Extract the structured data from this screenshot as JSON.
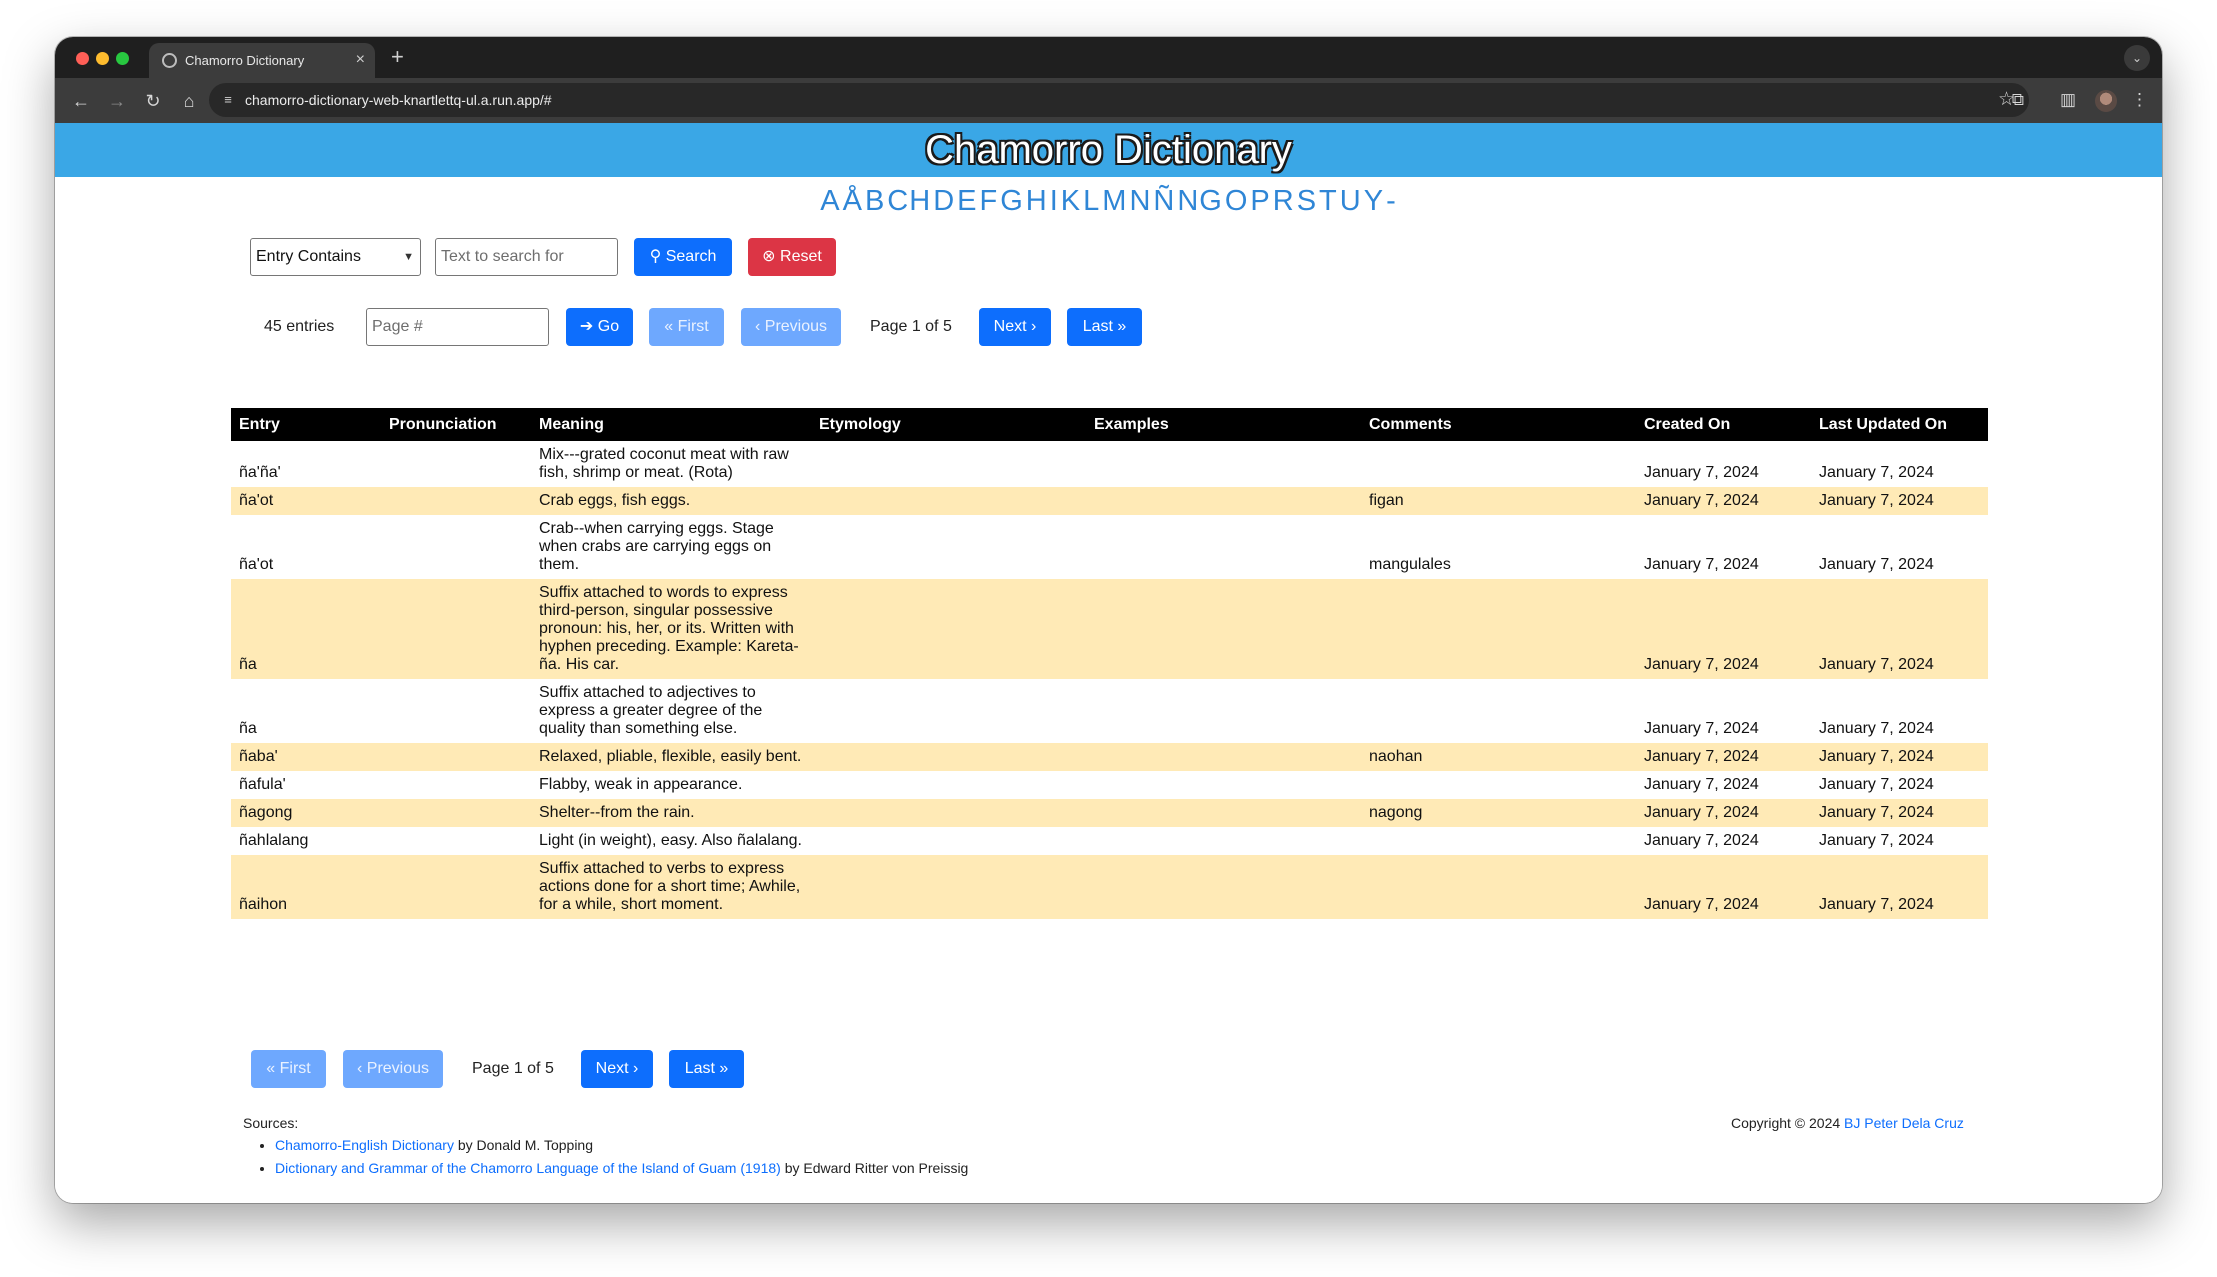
{
  "browser": {
    "tab_title": "Chamorro Dictionary",
    "tab_close": "×",
    "new_tab": "+",
    "url": "chamorro-dictionary-web-knartlettq-ul.a.run.app/#"
  },
  "header": {
    "title": "Chamorro Dictionary"
  },
  "alphabet": [
    "A",
    "Å",
    "B",
    "CH",
    "D",
    "E",
    "F",
    "G",
    "H",
    "I",
    "K",
    "L",
    "M",
    "N",
    "Ñ",
    "NG",
    "O",
    "P",
    "R",
    "S",
    "T",
    "U",
    "Y",
    "-"
  ],
  "search": {
    "mode_selected": "Entry Contains",
    "placeholder": "Text to search for",
    "search_label": "Search",
    "reset_label": "Reset"
  },
  "pagination": {
    "entries_count": "45 entries",
    "page_placeholder": "Page #",
    "go_label": "Go",
    "first_label": "First",
    "previous_label": "Previous",
    "page_status": "Page 1 of 5",
    "next_label": "Next",
    "last_label": "Last"
  },
  "table": {
    "columns": [
      "Entry",
      "Pronunciation",
      "Meaning",
      "Etymology",
      "Examples",
      "Comments",
      "Created On",
      "Last Updated On"
    ],
    "rows": [
      {
        "entry": "ña'ña'",
        "pronunciation": "",
        "meaning": "Mix---grated coconut meat with raw fish, shrimp or meat. (Rota)",
        "etymology": "",
        "examples": "",
        "comments": "",
        "created": "January 7, 2024",
        "updated": "January 7, 2024"
      },
      {
        "entry": "ña'ot",
        "pronunciation": "",
        "meaning": "Crab eggs, fish eggs.",
        "etymology": "",
        "examples": "",
        "comments": "figan",
        "created": "January 7, 2024",
        "updated": "January 7, 2024"
      },
      {
        "entry": "ña'ot",
        "pronunciation": "",
        "meaning": "Crab--when carrying eggs. Stage when crabs are carrying eggs on them.",
        "etymology": "",
        "examples": "",
        "comments": "mangulales",
        "created": "January 7, 2024",
        "updated": "January 7, 2024"
      },
      {
        "entry": "ña",
        "pronunciation": "",
        "meaning": "Suffix attached to words to express third-person, singular possessive pronoun: his, her, or its. Written with hyphen preceding. Example: Kareta-ña. His car.",
        "etymology": "",
        "examples": "",
        "comments": "",
        "created": "January 7, 2024",
        "updated": "January 7, 2024"
      },
      {
        "entry": "ña",
        "pronunciation": "",
        "meaning": "Suffix attached to adjectives to express a greater degree of the quality than something else.",
        "etymology": "",
        "examples": "",
        "comments": "",
        "created": "January 7, 2024",
        "updated": "January 7, 2024"
      },
      {
        "entry": "ñaba'",
        "pronunciation": "",
        "meaning": "Relaxed, pliable, flexible, easily bent.",
        "etymology": "",
        "examples": "",
        "comments": "naohan",
        "created": "January 7, 2024",
        "updated": "January 7, 2024"
      },
      {
        "entry": "ñafula'",
        "pronunciation": "",
        "meaning": "Flabby, weak in appearance.",
        "etymology": "",
        "examples": "",
        "comments": "",
        "created": "January 7, 2024",
        "updated": "January 7, 2024"
      },
      {
        "entry": "ñagong",
        "pronunciation": "",
        "meaning": "Shelter--from the rain.",
        "etymology": "",
        "examples": "",
        "comments": "nagong",
        "created": "January 7, 2024",
        "updated": "January 7, 2024"
      },
      {
        "entry": "ñahlalang",
        "pronunciation": "",
        "meaning": "Light (in weight), easy. Also ñalalang.",
        "etymology": "",
        "examples": "",
        "comments": "",
        "created": "January 7, 2024",
        "updated": "January 7, 2024"
      },
      {
        "entry": "ñaihon",
        "pronunciation": "",
        "meaning": "Suffix attached to verbs to express actions done for a short time; Awhile, for a while, short moment.",
        "etymology": "",
        "examples": "",
        "comments": "",
        "created": "January 7, 2024",
        "updated": "January 7, 2024"
      }
    ]
  },
  "footer": {
    "sources_label": "Sources:",
    "sources": [
      {
        "title": "Chamorro-English Dictionary",
        "author": " by Donald M. Topping"
      },
      {
        "title": "Dictionary and Grammar of the Chamorro Language of the Island of Guam (1918)",
        "author": " by Edward Ritter von Preissig"
      }
    ],
    "copyright_prefix": "Copyright © 2024 ",
    "copyright_author": "BJ Peter Dela Cruz"
  }
}
